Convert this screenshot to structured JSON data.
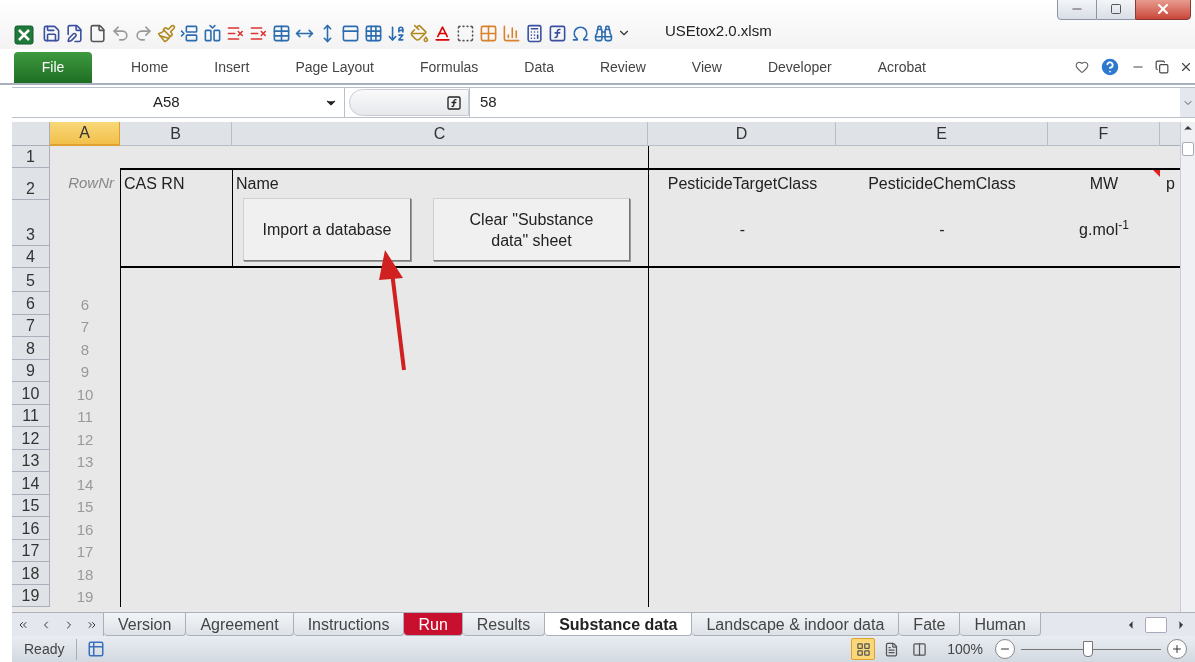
{
  "window": {
    "title": "USEtox2.0.xlsm"
  },
  "ribbon_tabs": [
    {
      "label": "File",
      "kind": "file"
    },
    {
      "label": "Home",
      "kind": "tab"
    },
    {
      "label": "Insert",
      "kind": "tab"
    },
    {
      "label": "Page Layout",
      "kind": "tab"
    },
    {
      "label": "Formulas",
      "kind": "tab"
    },
    {
      "label": "Data",
      "kind": "tab"
    },
    {
      "label": "Review",
      "kind": "tab"
    },
    {
      "label": "View",
      "kind": "tab"
    },
    {
      "label": "Developer",
      "kind": "tab"
    },
    {
      "label": "Acrobat",
      "kind": "tab"
    }
  ],
  "formula_bar": {
    "name_box": "A58",
    "formula": "58"
  },
  "column_headers": [
    {
      "label": "A",
      "selected": true
    },
    {
      "label": "B",
      "selected": false
    },
    {
      "label": "C",
      "selected": false
    },
    {
      "label": "D",
      "selected": false
    },
    {
      "label": "E",
      "selected": false
    },
    {
      "label": "F",
      "selected": false
    }
  ],
  "row_headers": [
    "1",
    "2",
    "3",
    "4",
    "5",
    "6",
    "7",
    "8",
    "9",
    "10",
    "11",
    "12",
    "13",
    "14",
    "15",
    "16",
    "17",
    "18",
    "19"
  ],
  "header_row": {
    "row_nr": "RowNr",
    "cas_rn": "CAS RN",
    "name": "Name",
    "columns": [
      {
        "heading": "PesticideTargetClass",
        "unit": "-",
        "comment": false
      },
      {
        "heading": "PesticideChemClass",
        "unit": "-",
        "comment": false
      },
      {
        "heading": "MW",
        "unit": "g.mol$^{-1}$",
        "comment": true
      },
      {
        "heading": "p",
        "comment": false
      }
    ]
  },
  "buttons": [
    "Import a database",
    "Clear \"Substance data\" sheet"
  ],
  "row_numbers": [
    "6",
    "7",
    "8",
    "9",
    "10",
    "11",
    "12",
    "13",
    "14",
    "15",
    "16",
    "17",
    "18",
    "19"
  ],
  "sheet_tabs": [
    {
      "label": "Version",
      "selected": false
    },
    {
      "label": "Agreement",
      "selected": false
    },
    {
      "label": "Instructions",
      "selected": false
    },
    {
      "label": "Run",
      "selected": false,
      "color": "#c8102e"
    },
    {
      "label": "Results",
      "selected": false
    },
    {
      "label": "Substance data",
      "selected": true
    },
    {
      "label": "Landscape & indoor data",
      "selected": false
    },
    {
      "label": "Fate",
      "selected": false
    },
    {
      "label": "Human",
      "selected": false
    }
  ],
  "status_bar": {
    "status": "Ready",
    "view_modes": [
      {
        "kind": "normal",
        "selected": true
      },
      {
        "kind": "page_layout",
        "selected": false
      },
      {
        "kind": "page_break",
        "selected": false
      }
    ],
    "zoom": "100%",
    "zoom_slider": {
      "level": 0.48
    }
  }
}
